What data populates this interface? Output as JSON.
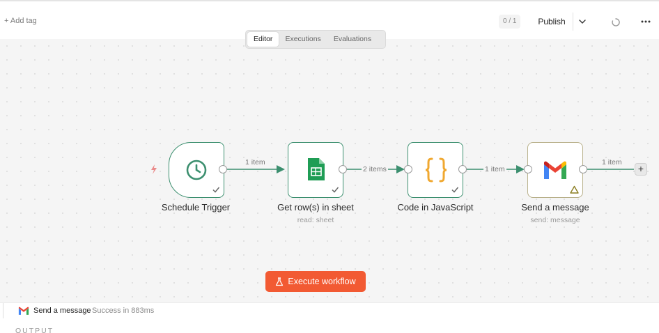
{
  "header": {
    "add_tag": "+ Add tag",
    "counter": "0 / 1",
    "publish_label": "Publish",
    "more_icon": "more-horizontal-icon",
    "sync_icon": "loading-spinner-icon"
  },
  "view_tabs": [
    {
      "label": "Editor",
      "active": true
    },
    {
      "label": "Executions",
      "active": false
    },
    {
      "label": "Evaluations",
      "active": false
    }
  ],
  "workflow": {
    "nodes": [
      {
        "id": "schedule",
        "label": "Schedule Trigger",
        "subtitle": "",
        "icon": "clock-icon",
        "status": "success"
      },
      {
        "id": "sheet",
        "label": "Get row(s) in sheet",
        "subtitle": "read: sheet",
        "icon": "google-sheets-icon",
        "status": "success"
      },
      {
        "id": "code",
        "label": "Code in JavaScript",
        "subtitle": "",
        "icon": "curly-braces-icon",
        "status": "success"
      },
      {
        "id": "gmail",
        "label": "Send a message",
        "subtitle": "send: message",
        "icon": "gmail-icon",
        "status": "warning"
      }
    ],
    "connections": [
      {
        "label": "1 item"
      },
      {
        "label": "2 items"
      },
      {
        "label": "1 item"
      },
      {
        "label": "1 item"
      }
    ]
  },
  "execute_button": {
    "label": "Execute workflow"
  },
  "bottom_panel": {
    "title": "Send a message",
    "status": "Success in 883ms",
    "output_label": "OUTPUT"
  },
  "colors": {
    "accent": "#f25a33",
    "success_edge": "#3c8f6f",
    "sheets_green": "#1f9d55",
    "code_orange": "#f0a830"
  }
}
